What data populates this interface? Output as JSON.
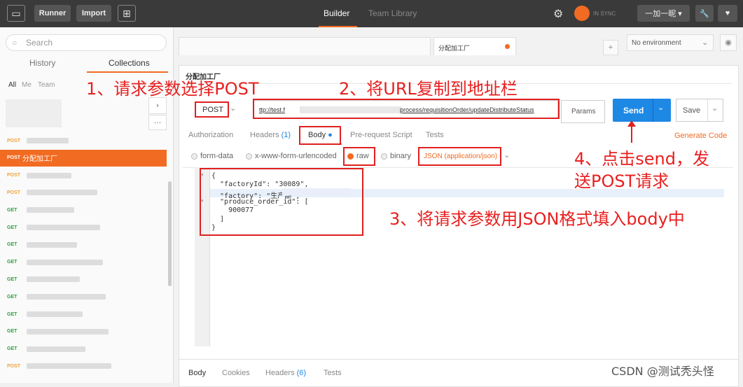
{
  "topbar": {
    "runner": "Runner",
    "import": "Import",
    "tab_builder": "Builder",
    "tab_team": "Team Library",
    "sync": "IN SYNC",
    "user": "一加一昵"
  },
  "sidebar": {
    "search_placeholder": "Search",
    "tab_history": "History",
    "tab_collections": "Collections",
    "filter_all": "All",
    "filter_me": "Me",
    "filter_team": "Team",
    "requests": [
      {
        "method": "POST",
        "name": ""
      },
      {
        "method": "POST",
        "name": "分配加工厂"
      },
      {
        "method": "POST",
        "name": ""
      },
      {
        "method": "POST",
        "name": ""
      },
      {
        "method": "GET",
        "name": ""
      },
      {
        "method": "GET",
        "name": ""
      },
      {
        "method": "GET",
        "name": ""
      },
      {
        "method": "GET",
        "name": ""
      },
      {
        "method": "GET",
        "name": ""
      },
      {
        "method": "GET",
        "name": ""
      },
      {
        "method": "GET",
        "name": ""
      },
      {
        "method": "GET",
        "name": ""
      },
      {
        "method": "GET",
        "name": ""
      },
      {
        "method": "POST",
        "name": ""
      }
    ]
  },
  "main": {
    "open_tab": "分配加工厂",
    "env": "No environment",
    "request_name": "分配加工厂",
    "method": "POST",
    "url_start": "ttp://test.f",
    "url_end": "process/requisitionOrder/updateDistributeStatus",
    "params": "Params",
    "send": "Send",
    "save": "Save",
    "subtabs": {
      "authorization": "Authorization",
      "headers": "Headers",
      "headers_count": "(1)",
      "body": "Body",
      "prerequest": "Pre-request Script",
      "tests": "Tests",
      "generate": "Generate Code"
    },
    "body_modes": {
      "form_data": "form-data",
      "urlencoded": "x-www-form-urlencoded",
      "raw": "raw",
      "binary": "binary",
      "content_type": "JSON (application/json)"
    },
    "code": [
      "{",
      "  \"factoryId\": \"30089\",",
      "  \"factory\": \"生产部\",",
      "  \"produce_order_id\": [",
      "    900077",
      "  ]",
      "}"
    ],
    "bottom_tabs": {
      "body": "Body",
      "cookies": "Cookies",
      "headers": "Headers",
      "headers_count": "(6)",
      "tests": "Tests"
    }
  },
  "annotations": {
    "a1": "1、请求参数选择POST",
    "a2": "2、将URL复制到地址栏",
    "a3": "3、将请求参数用JSON格式填入body中",
    "a4_line1": "4、点击send，发",
    "a4_line2": "送POST请求"
  },
  "watermark": "CSDN @测试秃头怪",
  "colors": {
    "accent_orange": "#f26b22",
    "send_blue": "#1e88e5",
    "annotation_red": "#e02020",
    "topbar": "#3a3a3a"
  }
}
